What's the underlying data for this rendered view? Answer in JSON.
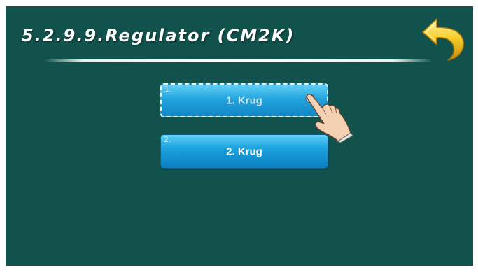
{
  "header": {
    "title": "5.2.9.9.Regulator (CM2K)",
    "back_icon": "back-arrow-icon"
  },
  "menu": {
    "items": [
      {
        "index": "1.",
        "label": "1. Krug",
        "state": "selected"
      },
      {
        "index": "2.",
        "label": "2. Krug",
        "state": "normal"
      }
    ]
  },
  "pointer_icon": "hand-pointer-icon",
  "colors": {
    "background": "#11534c",
    "button_top": "#5fcff7",
    "button_bottom": "#0b7fc2",
    "back_arrow": "#f2c11b",
    "title": "#ffffff"
  }
}
